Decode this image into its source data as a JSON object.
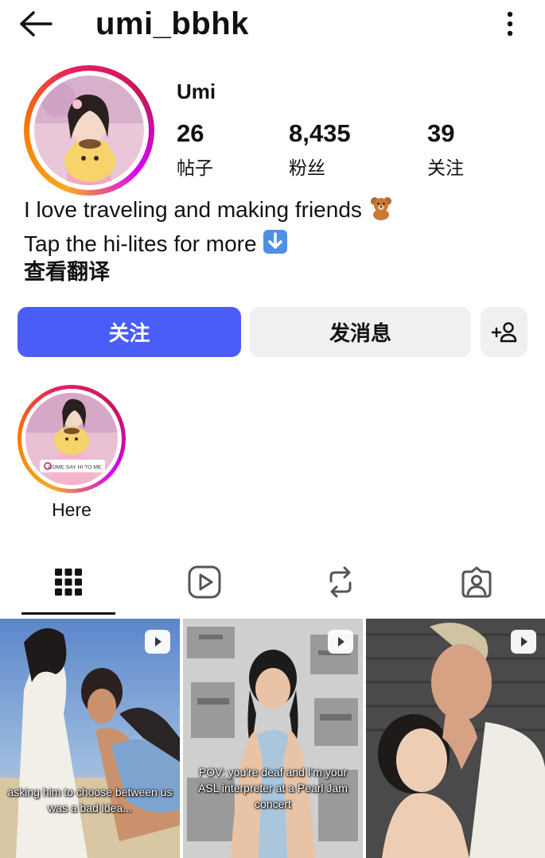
{
  "header": {
    "username": "umi_bbhk"
  },
  "profile": {
    "display_name": "Umi",
    "stats": [
      {
        "value": "26",
        "label": "帖子"
      },
      {
        "value": "8,435",
        "label": "粉丝"
      },
      {
        "value": "39",
        "label": "关注"
      }
    ],
    "bio_line1": "I love traveling and making friends",
    "bio_line2": "Tap the hi-lites for more",
    "translate_link": "查看翻译"
  },
  "actions": {
    "follow_label": "关注",
    "message_label": "发消息"
  },
  "highlights": [
    {
      "label": "Here",
      "sticker_text": "COME SAY HI TO ME"
    }
  ],
  "tabs": [
    "grid-icon",
    "reels-icon",
    "reposts-icon",
    "tagged-icon"
  ],
  "posts": [
    {
      "caption": "asking him to choose between us was a bad idea..."
    },
    {
      "caption": "POV: you're deaf and I'm your ASL interpreter at a Pearl Jam concert"
    },
    {
      "caption": ""
    }
  ],
  "colors": {
    "follow_button": "#4a5df9",
    "secondary_button": "#eff0f2"
  }
}
